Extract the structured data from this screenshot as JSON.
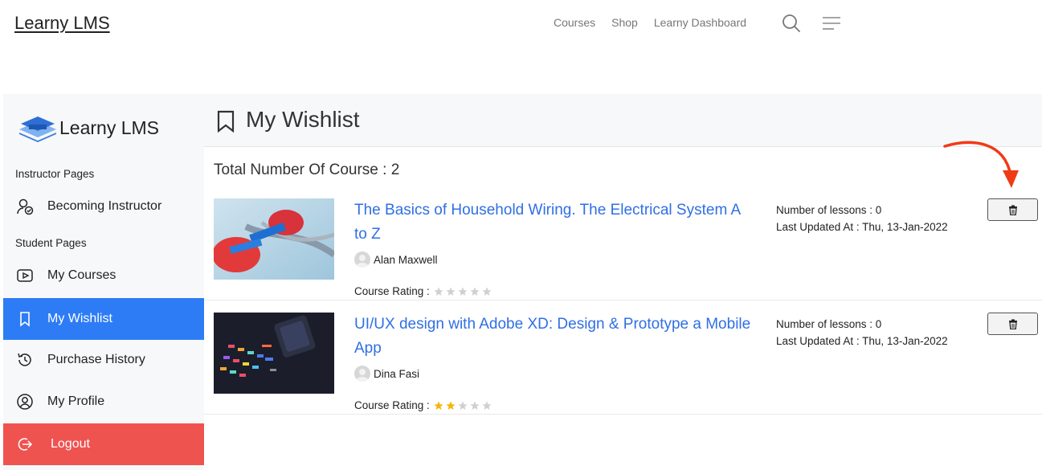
{
  "site": {
    "logo": "Learny LMS",
    "nav": [
      "Courses",
      "Shop",
      "Learny Dashboard"
    ]
  },
  "sidebar": {
    "brand": "Learny LMS",
    "instructor_label": "Instructor Pages",
    "student_label": "Student Pages",
    "items": [
      {
        "label": "Becoming Instructor",
        "icon": "user-check-icon"
      },
      {
        "label": "My Courses",
        "icon": "play-icon"
      },
      {
        "label": "My Wishlist",
        "icon": "bookmark-icon",
        "active": true
      },
      {
        "label": "Purchase History",
        "icon": "history-icon"
      },
      {
        "label": "My Profile",
        "icon": "user-circle-icon"
      },
      {
        "label": "Logout",
        "icon": "logout-icon"
      }
    ],
    "accent": "#2d7cf6",
    "logout_color": "#ef5350"
  },
  "main": {
    "title": "My Wishlist",
    "total": "Total Number Of Course : 2",
    "courses": [
      {
        "title": "The Basics of Household Wiring. The Electrical System A to Z",
        "author": "Alan Maxwell",
        "rating_label": "Course Rating :",
        "rating": 0,
        "lessons": "Number of lessons : 0",
        "updated": "Last Updated At : Thu, 13-Jan-2022"
      },
      {
        "title": "UI/UX design with Adobe XD: Design & Prototype a Mobile App",
        "author": "Dina Fasi",
        "rating_label": "Course Rating :",
        "rating": 2,
        "lessons": "Number of lessons : 0",
        "updated": "Last Updated At : Thu, 13-Jan-2022"
      }
    ]
  }
}
